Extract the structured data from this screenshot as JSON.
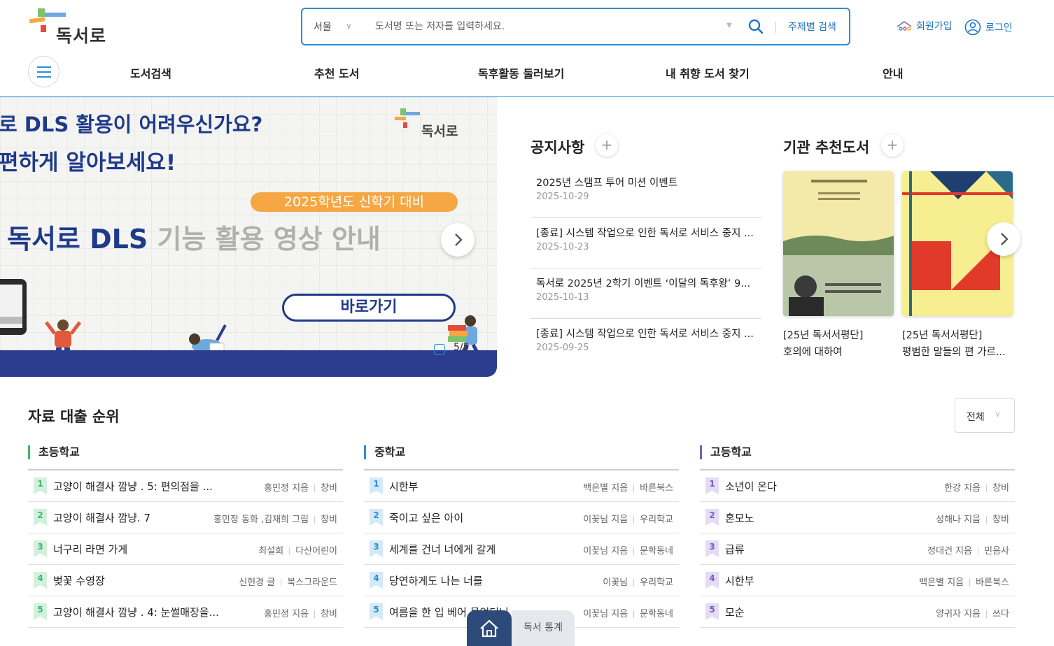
{
  "header": {
    "logo_text": "독서로",
    "search": {
      "region": "서울",
      "placeholder": "도서명 또는 저자를 입력하세요.",
      "theme_search": "주제별 검색"
    },
    "join": "회원가입",
    "login": "로그인"
  },
  "nav": {
    "items": [
      "도서검색",
      "추천 도서",
      "독후활동 둘러보기",
      "내 취향 도서 찾기",
      "안내"
    ]
  },
  "banner": {
    "line1": "로 DLS 활용이 어려우신가요?",
    "line2": "편하게 알아보세요!",
    "pill": "2025학년도 신학기 대비",
    "main_bold": "독서로 DLS ",
    "main_gray": "기능 활용 영상 안내",
    "cta": "바로가기",
    "counter": "5/5",
    "logo_text": "독서로"
  },
  "notices": {
    "title": "공지사항",
    "items": [
      {
        "title": "2025년 스탬프 투어 미션 이벤트",
        "date": "2025-10-29"
      },
      {
        "title": "[종료] 시스템 작업으로 인한 독서로 서비스 중지 ...",
        "date": "2025-10-23"
      },
      {
        "title": "독서로 2025년 2학기 이벤트 ‘이달의 독후왕’ 9...",
        "date": "2025-10-13"
      },
      {
        "title": "[종료] 시스템 작업으로 인한 독서로 서비스 중지 ...",
        "date": "2025-09-25"
      }
    ]
  },
  "recommend": {
    "title": "기관 추천도서",
    "books": [
      {
        "tag": "[25년 독서서평단]",
        "title": "호의에 대하여"
      },
      {
        "tag": "[25년 독서서평단]",
        "title": "평범한 말들의 편 가르..."
      }
    ]
  },
  "rankings": {
    "title": "자료 대출 순위",
    "filter": "전체",
    "columns": [
      {
        "name": "초등학교",
        "color": "#3cb86e",
        "badge_bg": "#d3f0dd",
        "rows": [
          {
            "rank": "1",
            "title": "고양이 해결사 깜냥 . 5: 편의점을 ...",
            "author": "홍민정 지음",
            "publisher": "창비"
          },
          {
            "rank": "2",
            "title": "고양이 해결사 깜냥. 7",
            "author": "홍민정 동화 ,김재희 그림",
            "publisher": "창비"
          },
          {
            "rank": "3",
            "title": "너구리 라면 가게",
            "author": "최설희",
            "publisher": "다산어린이"
          },
          {
            "rank": "4",
            "title": "벚꽃 수영장",
            "author": "신현경 글",
            "publisher": "북스그라운드"
          },
          {
            "rank": "5",
            "title": "고양이 해결사 깜냥 . 4: 눈썰매장을...",
            "author": "홍민정 지음",
            "publisher": "창비"
          }
        ]
      },
      {
        "name": "중학교",
        "color": "#2b8fd6",
        "badge_bg": "#d4e9f8",
        "rows": [
          {
            "rank": "1",
            "title": "시한부",
            "author": "백은별 지음",
            "publisher": "바른북스"
          },
          {
            "rank": "2",
            "title": "죽이고 싶은 아이",
            "author": "이꽃님 지음",
            "publisher": "우리학교"
          },
          {
            "rank": "3",
            "title": "세계를 건너 너에게 갈게",
            "author": "이꽃님 지음",
            "publisher": "문학동네"
          },
          {
            "rank": "4",
            "title": "당연하게도 나는 너를",
            "author": "이꽃님",
            "publisher": "우리학교"
          },
          {
            "rank": "5",
            "title": "여름을 한 입 베어 물었더니",
            "author": "이꽃님 지음",
            "publisher": "문학동네"
          }
        ]
      },
      {
        "name": "고등학교",
        "color": "#7b5cc4",
        "badge_bg": "#e4dcf5",
        "rows": [
          {
            "rank": "1",
            "title": "소년이 온다",
            "author": "한강 지음",
            "publisher": "창비"
          },
          {
            "rank": "2",
            "title": "혼모노",
            "author": "성해나 지음",
            "publisher": "창비"
          },
          {
            "rank": "3",
            "title": "급류",
            "author": "정대건 지음",
            "publisher": "민음사"
          },
          {
            "rank": "4",
            "title": "시한부",
            "author": "백은별 지음",
            "publisher": "바른북스"
          },
          {
            "rank": "5",
            "title": "모순",
            "author": "양귀자 지음",
            "publisher": "쓰다"
          }
        ]
      }
    ]
  },
  "bottom": {
    "stats": "독서 통계"
  }
}
